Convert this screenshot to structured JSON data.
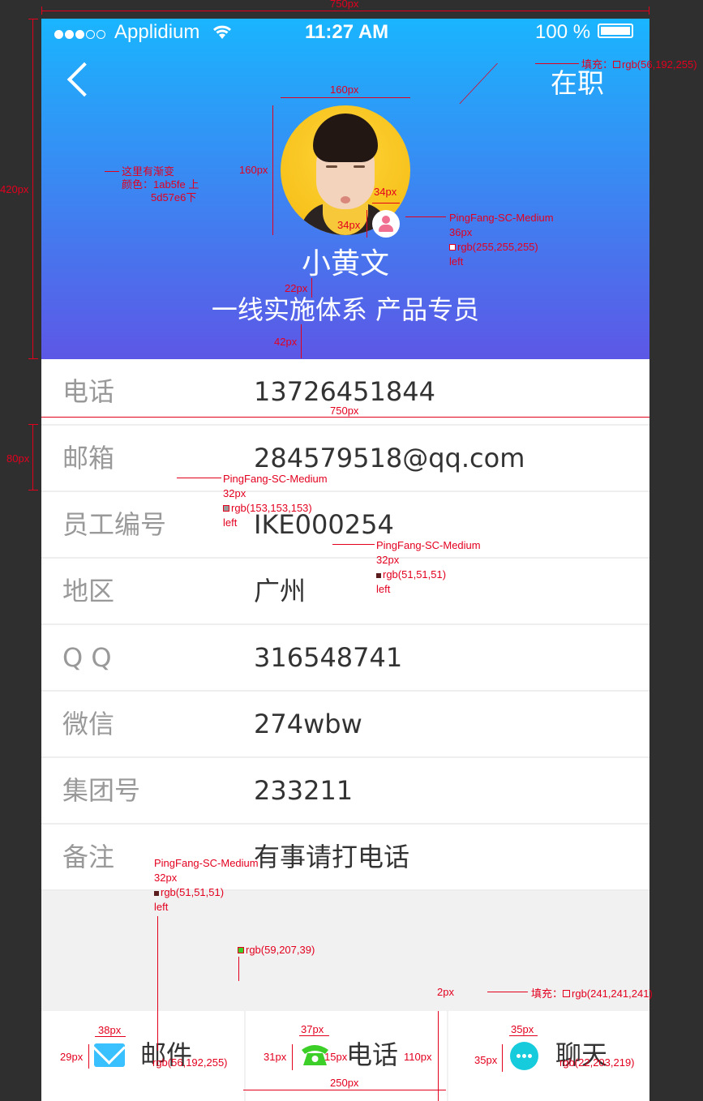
{
  "status_bar": {
    "carrier": "Applidium",
    "time": "11:27 AM",
    "battery": "100 %"
  },
  "header": {
    "status": "在职",
    "name": "小黄文",
    "department": "一线实施体系",
    "position": "产品专员",
    "gradient_top": "#1ab5fe",
    "gradient_bottom": "#5d57e6"
  },
  "info": [
    {
      "label": "电话",
      "value": "13726451844"
    },
    {
      "label": "邮箱",
      "value": "284579518@qq.com"
    },
    {
      "label": "员工编号",
      "value": "IKE000254"
    },
    {
      "label": "地区",
      "value": "广州"
    },
    {
      "label": "Q Q",
      "value": "316548741"
    },
    {
      "label": "微信",
      "value": "274wbw"
    },
    {
      "label": "集团号",
      "value": "233211"
    },
    {
      "label": "备注",
      "value": "有事请打电话"
    }
  ],
  "tabs": [
    {
      "label": "邮件",
      "icon": "mail-icon",
      "color": "#38c0ff"
    },
    {
      "label": "电话",
      "icon": "phone-icon",
      "color": "#3bcf27"
    },
    {
      "label": "聊天",
      "icon": "chat-icon",
      "color": "#16cbdb"
    }
  ],
  "annotations": {
    "w750": "750px",
    "w750b": "750px",
    "h420": "420px",
    "h80": "80px",
    "w160": "160px",
    "h160": "160px",
    "b34a": "34px",
    "b34b": "34px",
    "s22": "22px",
    "s42": "42px",
    "fill_title": "填充：",
    "fill_val": "rgb(56,192,255)",
    "grad1": "这里有渐变",
    "grad2": "颜色：1ab5fe 上",
    "grad3": "5d57e6下",
    "name_font": "PingFang-SC-Medium",
    "name_size": "36px",
    "name_color": "rgb(255,255,255)",
    "name_align": "left",
    "label_font": "PingFang-SC-Medium",
    "label_size": "32px",
    "label_color": "rgb(153,153,153)",
    "label_align": "left",
    "value_font": "PingFang-SC-Medium",
    "value_size": "32px",
    "value_color": "rgb(51,51,51)",
    "value_align": "left",
    "tab_font": "PingFang-SC-Medium",
    "tab_size": "32px",
    "tab_color": "rgb(51,51,51)",
    "tab_align": "left",
    "green": "rgb(59,207,39)",
    "w2": "2px",
    "fill2_title": "填充：",
    "fill2_val": "rgb(241,241,241)",
    "w38": "38px",
    "h29": "29px",
    "w37": "37px",
    "h31": "31px",
    "w15": "15px",
    "w35": "35px",
    "h35": "35px",
    "h110": "110px",
    "w250": "250px",
    "mail_color": "rgb(56,192,255)",
    "chat_color": "rgb(22,203,219)"
  }
}
